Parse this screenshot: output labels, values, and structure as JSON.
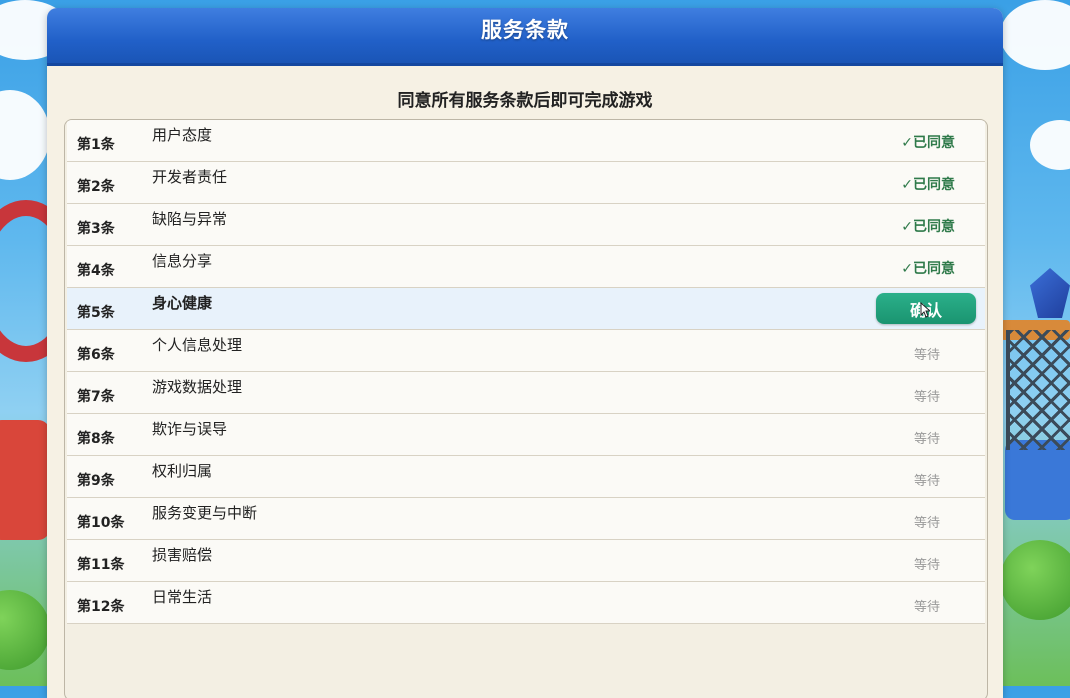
{
  "dialog": {
    "title": "服务条款",
    "subtitle": "同意所有服务条款后即可完成游戏"
  },
  "terms": [
    {
      "num": "第1条",
      "title": "用户态度",
      "status": "agreed",
      "status_label": "✓已同意"
    },
    {
      "num": "第2条",
      "title": "开发者责任",
      "status": "agreed",
      "status_label": "✓已同意"
    },
    {
      "num": "第3条",
      "title": "缺陷与异常",
      "status": "agreed",
      "status_label": "✓已同意"
    },
    {
      "num": "第4条",
      "title": "信息分享",
      "status": "agreed",
      "status_label": "✓已同意"
    },
    {
      "num": "第5条",
      "title": "身心健康",
      "status": "current",
      "status_label": "确认"
    },
    {
      "num": "第6条",
      "title": "个人信息处理",
      "status": "waiting",
      "status_label": "等待"
    },
    {
      "num": "第7条",
      "title": "游戏数据处理",
      "status": "waiting",
      "status_label": "等待"
    },
    {
      "num": "第8条",
      "title": "欺诈与误导",
      "status": "waiting",
      "status_label": "等待"
    },
    {
      "num": "第9条",
      "title": "权利归属",
      "status": "waiting",
      "status_label": "等待"
    },
    {
      "num": "第10条",
      "title": "服务变更与中断",
      "status": "waiting",
      "status_label": "等待"
    },
    {
      "num": "第11条",
      "title": "损害赔偿",
      "status": "waiting",
      "status_label": "等待"
    },
    {
      "num": "第12条",
      "title": "日常生活",
      "status": "waiting",
      "status_label": "等待"
    }
  ],
  "colors": {
    "header_blue": "#2160c8",
    "confirm_green": "#1a9470",
    "agreed_green": "#2f7a4a",
    "waiting_gray": "#9a9a9a"
  }
}
